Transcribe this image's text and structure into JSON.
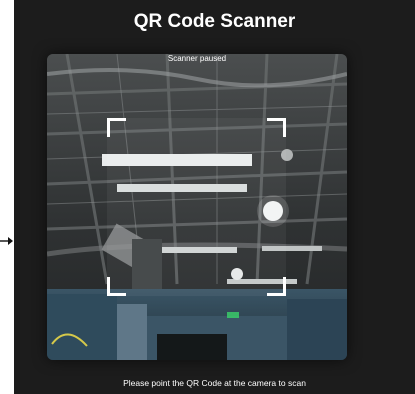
{
  "app": {
    "title": "QR Code Scanner",
    "accent": "#ffffff",
    "background": "#1c1c1c"
  },
  "scanner": {
    "status": "Scanner paused",
    "hint": "Please point the QR Code at the camera to scan"
  },
  "icons": {
    "left_arrow": "arrow-right-icon"
  }
}
